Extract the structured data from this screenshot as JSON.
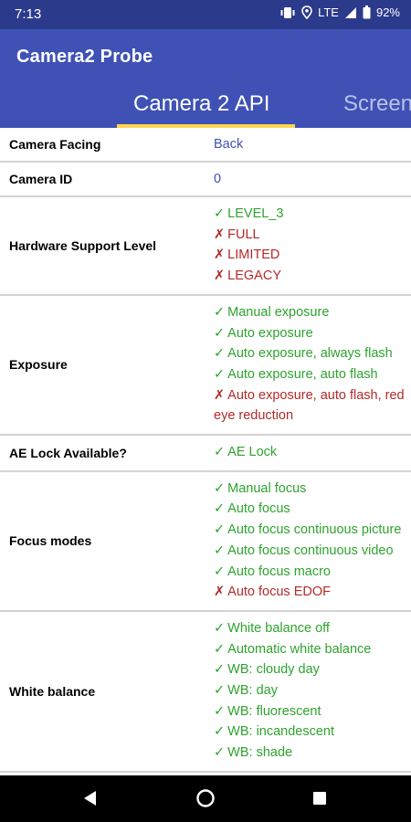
{
  "status_bar": {
    "time": "7:13",
    "network": "LTE",
    "battery": "92%",
    "icons": [
      "vibrate-icon",
      "location-icon",
      "signal-icon",
      "battery-icon"
    ]
  },
  "app_bar": {
    "title": "Camera2 Probe"
  },
  "tabs": [
    {
      "label": "Camera 2 API",
      "active": true
    },
    {
      "label": "Screen",
      "active": false
    }
  ],
  "rows": [
    {
      "label": "Camera Facing",
      "value": "Back"
    },
    {
      "label": "Camera ID",
      "value": "0"
    },
    {
      "label": "Hardware Support Level",
      "items": [
        {
          "ok": true,
          "text": "LEVEL_3"
        },
        {
          "ok": false,
          "text": "FULL"
        },
        {
          "ok": false,
          "text": "LIMITED"
        },
        {
          "ok": false,
          "text": "LEGACY"
        }
      ]
    },
    {
      "label": "Exposure",
      "items": [
        {
          "ok": true,
          "text": "Manual exposure"
        },
        {
          "ok": true,
          "text": "Auto exposure"
        },
        {
          "ok": true,
          "text": "Auto exposure, always flash"
        },
        {
          "ok": true,
          "text": "Auto exposure, auto flash"
        },
        {
          "ok": false,
          "text": "Auto exposure, auto flash, red eye reduction"
        }
      ]
    },
    {
      "label": "AE Lock Available?",
      "items": [
        {
          "ok": true,
          "text": "AE Lock"
        }
      ]
    },
    {
      "label": "Focus modes",
      "items": [
        {
          "ok": true,
          "text": "Manual focus"
        },
        {
          "ok": true,
          "text": "Auto focus"
        },
        {
          "ok": true,
          "text": "Auto focus continuous picture"
        },
        {
          "ok": true,
          "text": "Auto focus continuous video"
        },
        {
          "ok": true,
          "text": "Auto focus macro"
        },
        {
          "ok": false,
          "text": "Auto focus EDOF"
        }
      ]
    },
    {
      "label": "White balance",
      "items": [
        {
          "ok": true,
          "text": "White balance off"
        },
        {
          "ok": true,
          "text": "Automatic white balance"
        },
        {
          "ok": true,
          "text": "WB: cloudy day"
        },
        {
          "ok": true,
          "text": "WB: day"
        },
        {
          "ok": true,
          "text": "WB: fluorescent"
        },
        {
          "ok": true,
          "text": "WB: incandescent"
        },
        {
          "ok": true,
          "text": "WB: shade"
        }
      ]
    }
  ],
  "marks": {
    "yes": "✓",
    "no": "✗"
  },
  "colors": {
    "primary": "#3f51b5",
    "status_bar": "#2c3a8c",
    "tab_indicator": "#ffd54f",
    "supported": "#2ea32e",
    "unsupported": "#b32a2a"
  },
  "nav_bar": {
    "icons": [
      "back-icon",
      "home-icon",
      "recents-icon"
    ]
  }
}
